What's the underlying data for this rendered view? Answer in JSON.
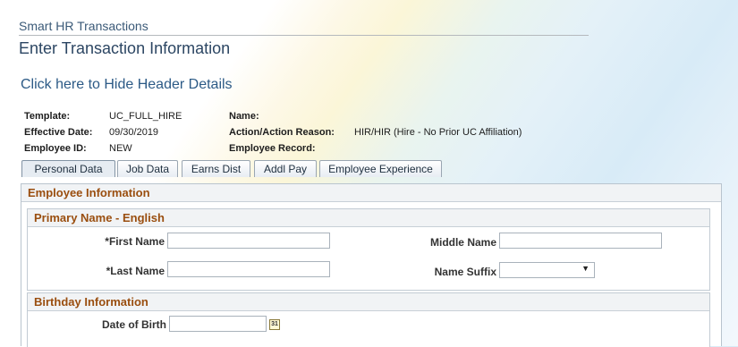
{
  "breadcrumb": "Smart HR Transactions",
  "page_title": "Enter Transaction Information",
  "hide_header_link": "Click here to Hide Header Details",
  "header": {
    "template_label": "Template:",
    "template_value": "UC_FULL_HIRE",
    "effective_date_label": "Effective Date:",
    "effective_date_value": "09/30/2019",
    "employee_id_label": "Employee ID:",
    "employee_id_value": "NEW",
    "name_label": "Name:",
    "name_value": "",
    "action_label": "Action/Action Reason:",
    "action_value": "HIR/HIR (Hire - No Prior UC Affiliation)",
    "employee_record_label": "Employee Record:",
    "employee_record_value": ""
  },
  "tabs": [
    {
      "label": "Personal Data",
      "active": true
    },
    {
      "label": "Job Data",
      "active": false
    },
    {
      "label": "Earns Dist",
      "active": false
    },
    {
      "label": "Addl Pay",
      "active": false
    },
    {
      "label": "Employee Experience",
      "active": false
    }
  ],
  "employee_information": {
    "title": "Employee Information",
    "primary_name": {
      "title": "Primary Name - English",
      "first_name_label": "*First Name",
      "first_name_value": "",
      "last_name_label": "*Last Name",
      "last_name_value": "",
      "middle_name_label": "Middle Name",
      "middle_name_value": "",
      "name_suffix_label": "Name Suffix",
      "name_suffix_value": ""
    },
    "birthday": {
      "title": "Birthday Information",
      "date_of_birth_label": "Date of Birth",
      "date_of_birth_value": "",
      "calendar_icon_text": "31"
    }
  },
  "icons": {
    "calendar": "calendar-icon",
    "dropdown": "chevron-down-icon"
  },
  "colors": {
    "section_title": "#9a4e0f",
    "link": "#2c5a86",
    "page_title": "#2c4663"
  }
}
